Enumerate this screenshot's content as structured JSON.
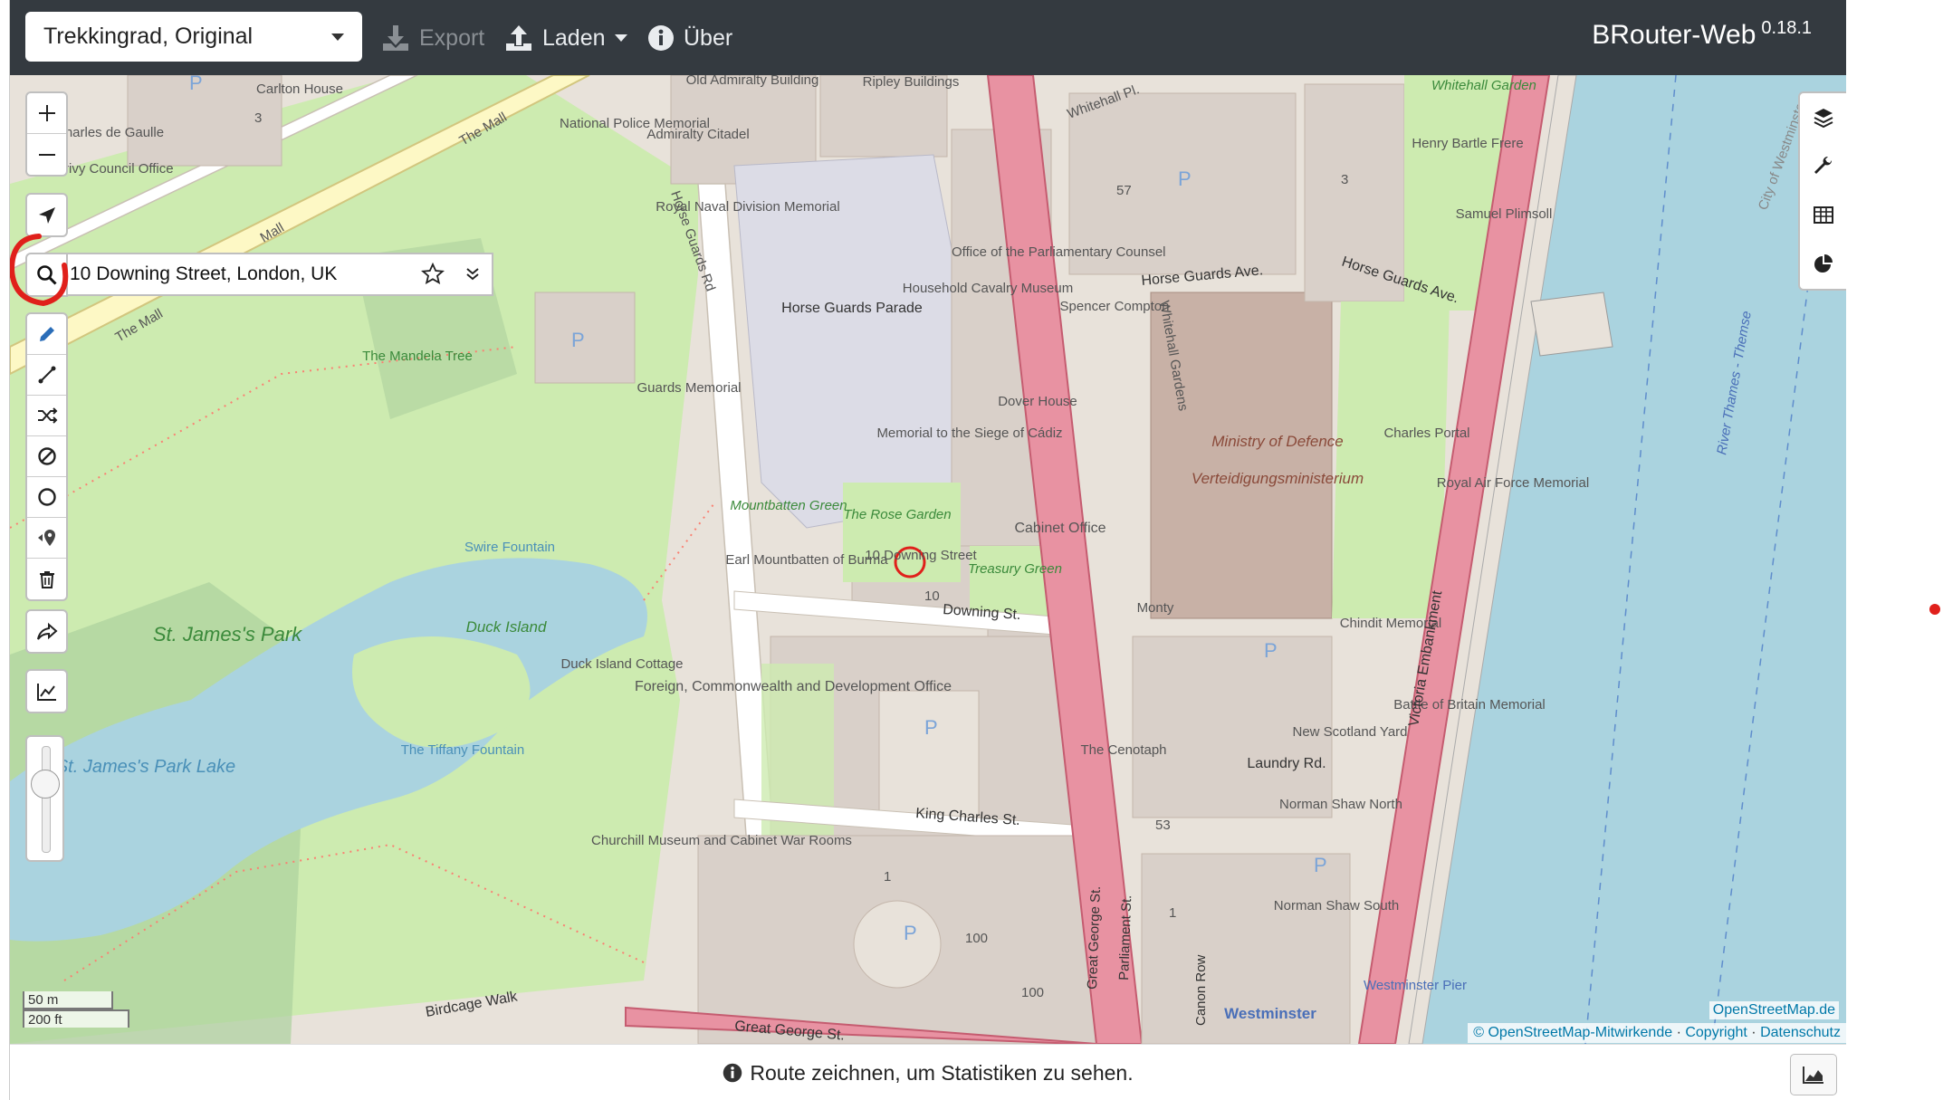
{
  "navbar": {
    "profile": "Trekkingrad, Original",
    "export_label": "Export",
    "load_label": "Laden",
    "about_label": "Über",
    "brand": "BRouter-Web",
    "version": "0.18.1"
  },
  "search": {
    "value": "10 Downing Street, London, UK"
  },
  "map_labels": {
    "carlton_house": "Carlton House",
    "old_admiralty": "Old Admiralty Building",
    "ripley": "Ripley Buildings",
    "whitehall": "Whitehall",
    "whitehall_pl": "Whitehall Pl.",
    "whitehall_garden": "Whitehall Garden",
    "victoria_emb": "Victoria Emb.",
    "the_mall": "The Mall",
    "mall": "Mall",
    "charles_de_gaulle": "Charles de Gaulle",
    "privy_council": "Privy Council Office",
    "national_police": "National Police Memorial",
    "admiralty_citadel": "Admiralty Citadel",
    "royal_naval": "Royal Naval Division Memorial",
    "office_parliamentary": "Office of the Parliamentary Counsel",
    "horse_guards_rd": "Horse Guards Rd",
    "horse_guards_parade": "Horse Guards Parade",
    "household_cavalry": "Household Cavalry Museum",
    "horse_guards_ave": "Horse Guards Ave.",
    "henry_bartle_frere": "Henry Bartle Frere",
    "samuel_plimsoll": "Samuel Plimsoll",
    "spencer_compton": "Spencer Compton",
    "whitehall_gardens": "Whitehall Gardens",
    "mandela_tree": "The Mandela Tree",
    "guards_memorial": "Guards Memorial",
    "dover_house": "Dover House",
    "memorial_cadiz": "Memorial to the Siege of Cádiz",
    "ministry_defence": "Ministry of Defence",
    "verteidigung": "Verteidigungsministerium",
    "charles_portal": "Charles Portal",
    "royal_air_force": "Royal Air Force Memorial",
    "swire_fountain": "Swire Fountain",
    "mountbatten_green": "Mountbatten Green",
    "rose_garden": "The Rose Garden",
    "cabinet_office": "Cabinet Office",
    "downing_10": "10 Downing Street",
    "earl_mountbatten": "Earl Mountbatten of Burma",
    "treasury_green": "Treasury Green",
    "monty": "Monty",
    "chindit": "Chindit Memorial",
    "st_james_park": "St. James's Park",
    "duck_island": "Duck Island",
    "duck_island_cottage": "Duck Island Cottage",
    "downing_st": "Downing St.",
    "foreign_office": "Foreign, Commonwealth and Development Office",
    "new_scotland_yard": "New Scotland Yard",
    "battle_britain": "Battle of Britain Memorial",
    "victoria_embankment": "Victoria Embankment",
    "river_thames": "River Thames - Themse",
    "city_westminster": "City of Westminster",
    "st_james_lake": "St. James's Park Lake",
    "tiffany_fountain": "The Tiffany Fountain",
    "cenotaph": "The Cenotaph",
    "laundry_rd": "Laundry Rd.",
    "king_charles_st": "King Charles St.",
    "churchill_museum": "Churchill Museum and Cabinet War Rooms",
    "norman_shaw_north": "Norman Shaw North",
    "norman_shaw_south": "Norman Shaw South",
    "great_george_st": "Great George St.",
    "parliament_st": "Parliament St.",
    "canon_row": "Canon Row",
    "westminster": "Westminster",
    "westminster_pier": "Westminster Pier",
    "birdcage_walk": "Birdcage Walk",
    "num_57": "57",
    "num_10": "10",
    "num_100a": "100",
    "num_100b": "100",
    "num_53": "53",
    "num_1": "1",
    "num_3": "3",
    "p": "P"
  },
  "scale": {
    "metric": "50 m",
    "imperial": "200 ft"
  },
  "attribution": {
    "osm": "OpenStreetMap.de",
    "contributors": "© OpenStreetMap-Mitwirkende",
    "copyright": "Copyright",
    "privacy": "Datenschutz",
    "sep": "·"
  },
  "footer": {
    "message": "Route zeichnen, um Statistiken zu sehen."
  },
  "colors": {
    "navbar": "#343a40",
    "park": "#cdebb0",
    "water": "#aad3df",
    "primary_road": "#e892a2",
    "building": "#d9d0c9",
    "annotation": "#e0201b"
  }
}
